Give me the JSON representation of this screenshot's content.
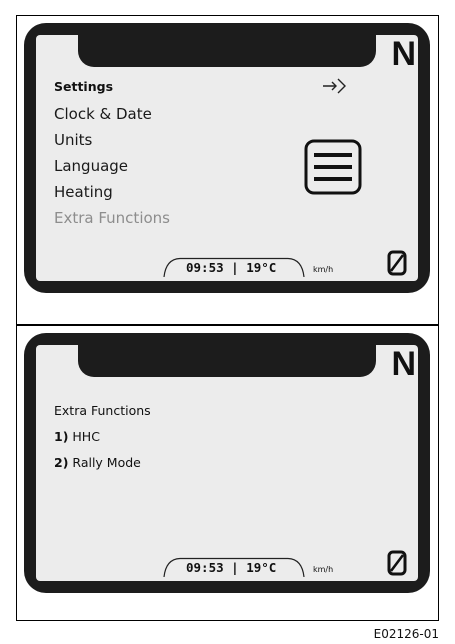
{
  "screen_1": {
    "gear": "N",
    "menu_title": "Settings",
    "items": [
      {
        "label": "Clock & Date"
      },
      {
        "label": "Units"
      },
      {
        "label": "Language"
      },
      {
        "label": "Heating"
      },
      {
        "label": "Extra Functions",
        "highlighted": true
      }
    ],
    "status": {
      "time": "09:53",
      "separator": "|",
      "temperature": "19°C",
      "speed_unit": "km/h"
    },
    "icons": [
      "enter-arrow-icon",
      "hamburger-menu-icon",
      "speed-zero-icon"
    ]
  },
  "screen_2": {
    "gear": "N",
    "menu_title": "Extra Functions",
    "items": [
      {
        "number": "1)",
        "label": "HHC"
      },
      {
        "number": "2)",
        "label": "Rally Mode"
      }
    ],
    "status": {
      "time": "09:53",
      "separator": "|",
      "temperature": "19°C",
      "speed_unit": "km/h"
    },
    "icons": [
      "speed-zero-icon"
    ]
  },
  "figure_code": "E02126-01"
}
